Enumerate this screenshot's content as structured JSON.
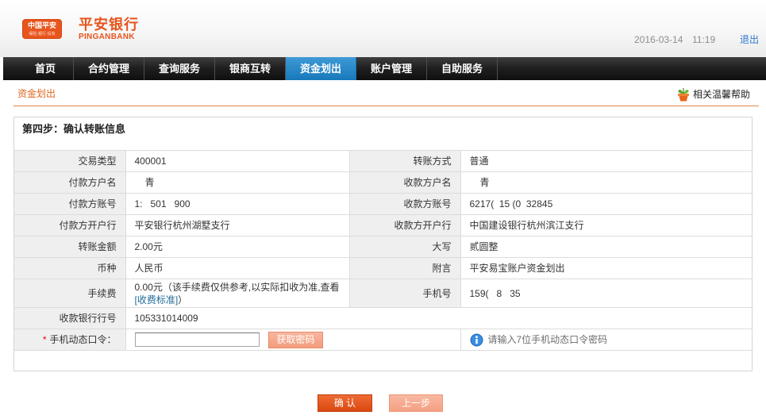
{
  "colors": {
    "brand_orange": "#e8541d",
    "nav_active": "#1a86cf",
    "required_mark": "#e60012",
    "link": "#236c9b"
  },
  "header": {
    "logo_badge": "中国平安",
    "logo_badge_sub": "保险·银行·投资",
    "bank_name": "平安银行",
    "bank_name_en": "PINGANBANK",
    "date": "2016-03-14",
    "time": "11:19",
    "logout": "退出"
  },
  "nav": {
    "items": [
      {
        "label": "首页",
        "active": false
      },
      {
        "label": "合约管理",
        "active": false
      },
      {
        "label": "查询服务",
        "active": false
      },
      {
        "label": "银商互转",
        "active": false
      },
      {
        "label": "资金划出",
        "active": true
      },
      {
        "label": "账户管理",
        "active": false
      },
      {
        "label": "自助服务",
        "active": false
      }
    ]
  },
  "breadcrumb": {
    "current": "资金划出",
    "help_icon": "flower-pot-icon",
    "help_label": "相关温馨帮助"
  },
  "form": {
    "step_title": "第四步：确认转账信息",
    "rows": [
      {
        "label1": "交易类型",
        "value1": "400001",
        "label2": "转账方式",
        "value2": "普通"
      },
      {
        "label1": "付款方户名",
        "value1": "青",
        "label2": "收款方户名",
        "value2": "青"
      },
      {
        "label1": "付款方账号",
        "value1": "1:   501   900",
        "label2": "收款方账号",
        "value2": "6217(  15 (0  32845"
      },
      {
        "label1": "付款方开户行",
        "value1": "平安银行杭州湖墅支行",
        "label2": "收款方开户行",
        "value2": "中国建设银行杭州滨江支行"
      },
      {
        "label1": "转账金额",
        "value1": "2.00元",
        "label2": "大写",
        "value2": "贰圆整"
      },
      {
        "label1": "币种",
        "value1": "人民币",
        "label2": "附言",
        "value2": "平安易宝账户资金划出"
      },
      {
        "label1": "手续费",
        "value1": "0.00元（该手续费仅供参考,以实际扣收为准,查看",
        "value1_link": "[收费标准]",
        "value1_after": "）",
        "label2": "手机号",
        "value2": "159(   8   35"
      },
      {
        "label1": "收款银行行号",
        "value1": "105331014009"
      }
    ],
    "otp": {
      "required_mark": "*",
      "label": "手机动态口令：",
      "input_value": "",
      "get_code_button": "获取密码",
      "hint_icon": "info-icon",
      "hint": "请输入7位手机动态口令密码"
    }
  },
  "actions": {
    "confirm": "确 认",
    "back": "上一步"
  }
}
